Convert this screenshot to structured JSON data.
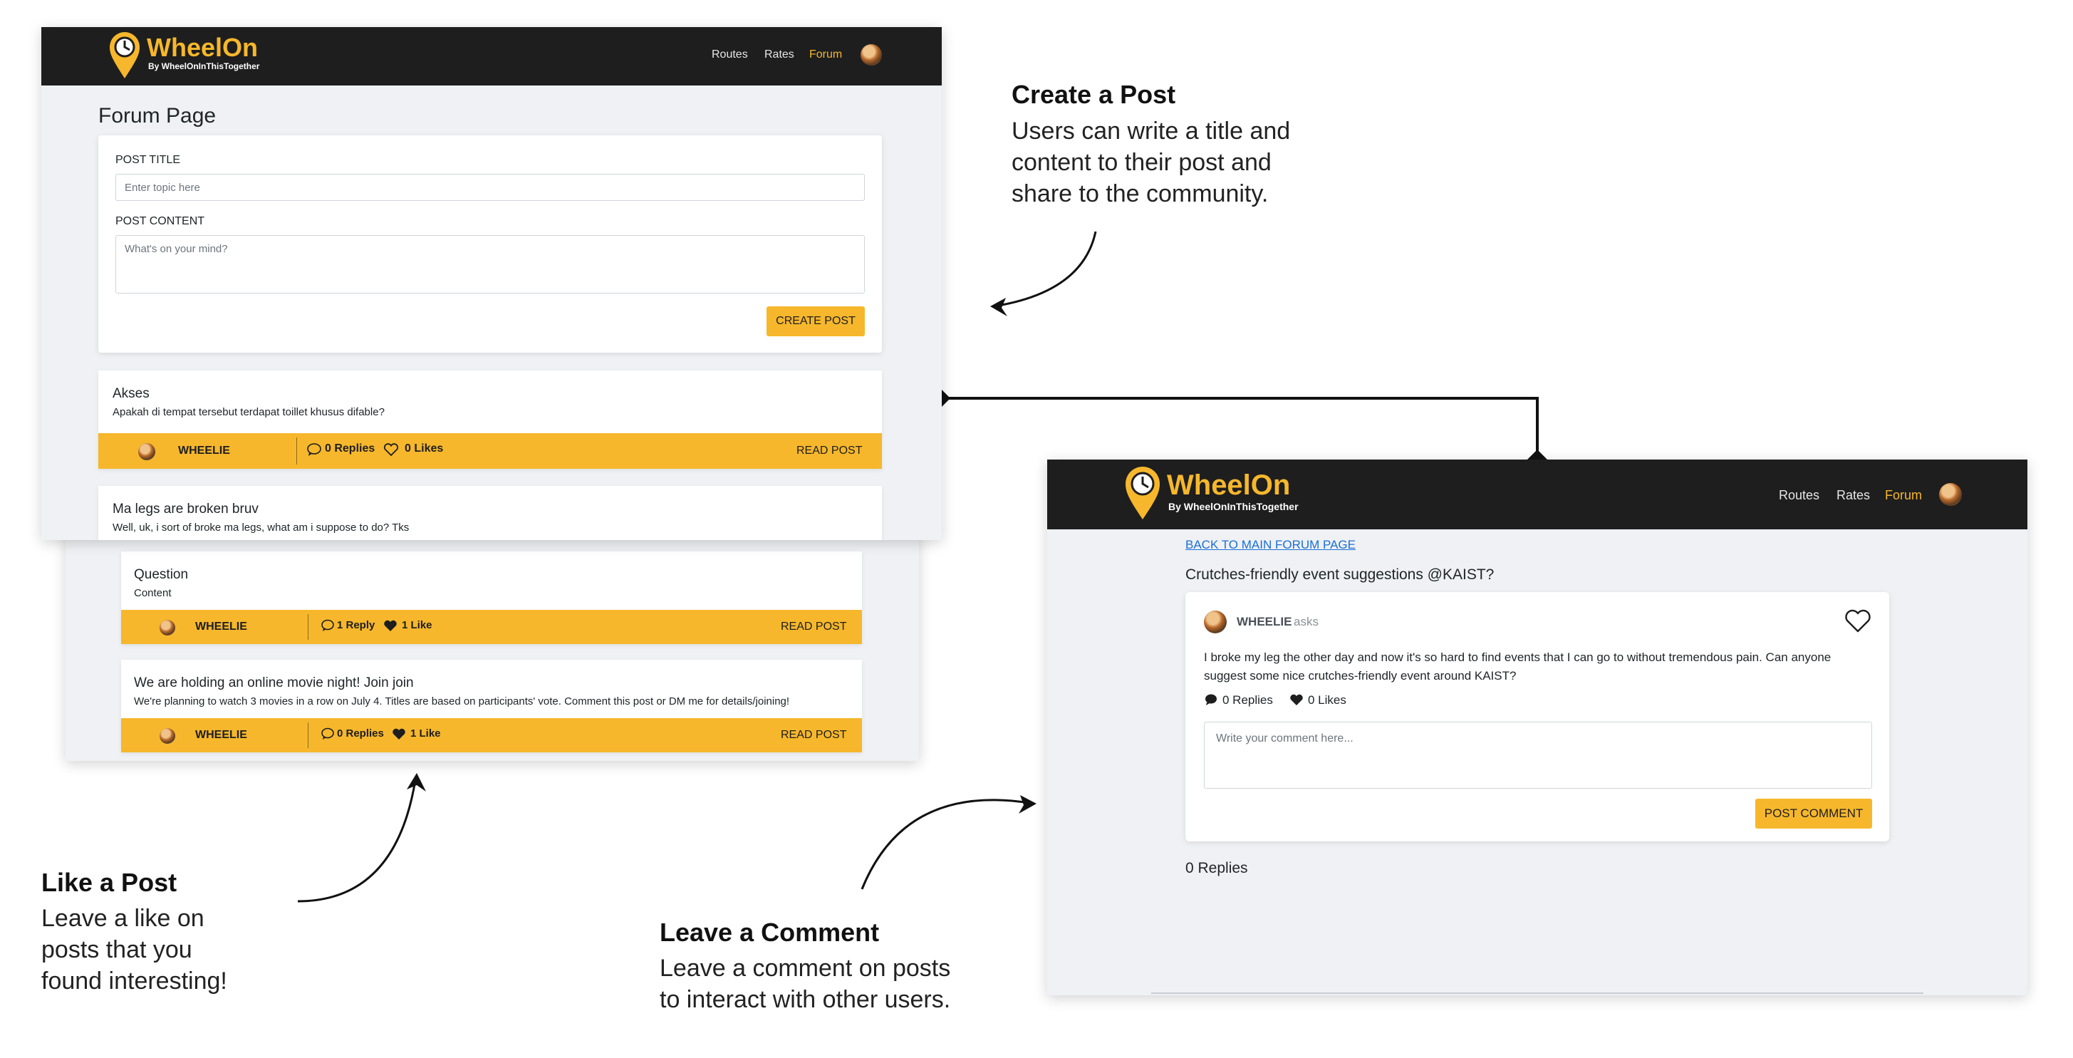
{
  "brand": {
    "name": "WheelOn",
    "tagline": "By WheelOnInThisTogether"
  },
  "nav": {
    "routes": "Routes",
    "rates": "Rates",
    "forum": "Forum"
  },
  "forum": {
    "page_title": "Forum Page",
    "post_title_label": "POST TITLE",
    "post_title_placeholder": "Enter topic here",
    "post_content_label": "POST CONTENT",
    "post_content_placeholder": "What's on your mind?",
    "create_button": "CREATE POST",
    "posts": [
      {
        "title": "Akses",
        "body": "Apakah di tempat tersebut terdapat toillet khusus difable?",
        "author": "WHEELIE",
        "replies": "0 Replies",
        "likes": "0 Likes",
        "read": "READ POST"
      },
      {
        "title": "Ma legs are broken bruv",
        "body": "Well, uk, i sort of broke ma legs, what am i suppose to do? Tks"
      },
      {
        "title": "Question",
        "body": "Content",
        "author": "WHEELIE",
        "replies": "1 Reply",
        "likes": "1 Like",
        "read": "READ POST"
      },
      {
        "title": "We are holding an online movie night! Join join",
        "body": "We're planning to watch 3 movies in a row on July 4. Titles are based on participants' vote. Comment this post or DM me for details/joining!",
        "author": "WHEELIE",
        "replies": "0 Replies",
        "likes": "1 Like",
        "read": "READ POST"
      }
    ]
  },
  "detail": {
    "back_link": "BACK TO MAIN FORUM PAGE",
    "title": "Crutches-friendly event suggestions @KAIST?",
    "author": "WHEELIE",
    "asks": "asks",
    "body_line1": "I broke my leg the other day and now it's so hard to find events that I can go to without tremendous pain. Can anyone",
    "body_line2": "suggest some nice crutches-friendly event around KAIST?",
    "replies": "0 Replies",
    "likes": "0 Likes",
    "comment_placeholder": "Write your comment here...",
    "comment_button": "POST COMMENT",
    "replies_heading": "0 Replies"
  },
  "annotations": {
    "create": {
      "title": "Create a Post",
      "lines": [
        "Users can write a title and",
        "content to their post and",
        "share to the community."
      ]
    },
    "like": {
      "title": "Like a Post",
      "lines": [
        "Leave a like on",
        "posts that you",
        "found interesting!"
      ]
    },
    "comment": {
      "title": "Leave a Comment",
      "lines": [
        "Leave a comment on posts",
        "to interact with other users."
      ]
    }
  },
  "colors": {
    "accent": "#f6b72c",
    "navbar": "#1e1e1e",
    "page_bg": "#eff1f4"
  }
}
